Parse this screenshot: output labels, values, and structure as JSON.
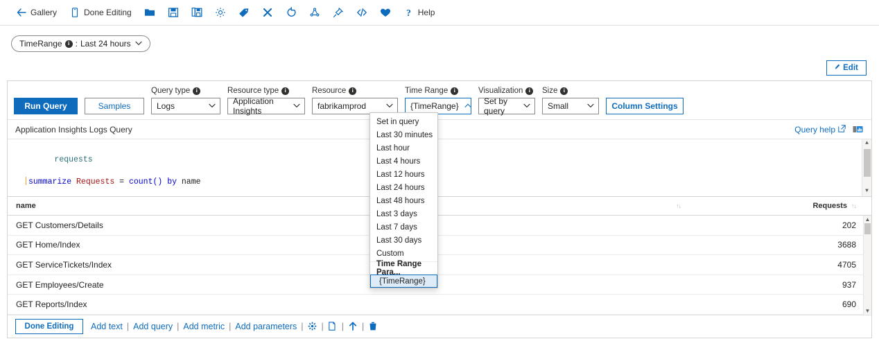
{
  "toolbar": {
    "items": [
      {
        "icon": "back-arrow-icon",
        "label": "Gallery"
      },
      {
        "icon": "phone-done-icon",
        "label": "Done Editing"
      },
      {
        "icon": "open-folder-icon",
        "label": ""
      },
      {
        "icon": "save-icon",
        "label": ""
      },
      {
        "icon": "save-as-icon",
        "label": ""
      },
      {
        "icon": "gear-icon",
        "label": ""
      },
      {
        "icon": "tag-icon",
        "label": ""
      },
      {
        "icon": "close-icon",
        "label": ""
      },
      {
        "icon": "refresh-icon",
        "label": ""
      },
      {
        "icon": "share-icon",
        "label": ""
      },
      {
        "icon": "pin-icon",
        "label": ""
      },
      {
        "icon": "code-icon",
        "label": ""
      },
      {
        "icon": "heart-icon",
        "label": ""
      },
      {
        "icon": "help-icon",
        "label": "Help"
      }
    ]
  },
  "parameters": {
    "pill": {
      "name": "TimeRange",
      "separator": ":",
      "value": "Last 24 hours",
      "chevron": "⌄"
    }
  },
  "edit_button": {
    "label": "Edit",
    "icon": "pencil-icon"
  },
  "query_bar": {
    "run_query_label": "Run Query",
    "samples_label": "Samples",
    "column_settings_label": "Column Settings",
    "fields": [
      {
        "label": "Query type",
        "value": "Logs"
      },
      {
        "label": "Resource type",
        "value": "Application Insights"
      },
      {
        "label": "Resource",
        "value": "fabrikamprod"
      },
      {
        "label": "Time Range",
        "value": "{TimeRange}"
      },
      {
        "label": "Visualization",
        "value": "Set by query"
      },
      {
        "label": "Size",
        "value": "Small"
      }
    ]
  },
  "time_range_dropdown": {
    "options": [
      "Set in query",
      "Last 30 minutes",
      "Last hour",
      "Last 4 hours",
      "Last 12 hours",
      "Last 24 hours",
      "Last 48 hours",
      "Last 3 days",
      "Last 7 days",
      "Last 30 days",
      "Custom"
    ],
    "group_header": "Time Range Para...",
    "selected": "{TimeRange}"
  },
  "query_editor": {
    "title": "Application Insights Logs Query",
    "query_help_label": "Query help",
    "query_help_icon": "external-link-icon",
    "samples_badge_icon": "chart-badge-icon",
    "code": {
      "line1": "requests",
      "line2_tokens": [
        {
          "t": "summarize",
          "c": "op"
        },
        {
          "t": "Requests",
          "c": "id"
        },
        {
          "t": "=",
          "c": "plain"
        },
        {
          "t": "count()",
          "c": "fn"
        },
        {
          "t": "by",
          "c": "by"
        },
        {
          "t": "name",
          "c": "plain"
        }
      ]
    }
  },
  "results_table": {
    "columns": [
      {
        "key": "name",
        "label": "name",
        "align": "left"
      },
      {
        "key": "requests",
        "label": "Requests",
        "align": "right"
      }
    ],
    "sort_icon": "↑↓",
    "rows": [
      {
        "name": "GET Customers/Details",
        "requests": "202"
      },
      {
        "name": "GET Home/Index",
        "requests": "3688"
      },
      {
        "name": "GET ServiceTickets/Index",
        "requests": "4705"
      },
      {
        "name": "GET Employees/Create",
        "requests": "937"
      },
      {
        "name": "GET Reports/Index",
        "requests": "690"
      }
    ]
  },
  "footer": {
    "done_editing_label": "Done Editing",
    "links": [
      "Add text",
      "Add query",
      "Add metric",
      "Add parameters"
    ],
    "separator": "|",
    "icons": [
      "gear-icon",
      "copy-icon",
      "move-up-icon",
      "delete-icon"
    ]
  },
  "colors": {
    "accent": "#0f6cbd",
    "selected_row_bg": "#deecf9",
    "border": "#d6d4d2",
    "text": "#201f1e"
  }
}
